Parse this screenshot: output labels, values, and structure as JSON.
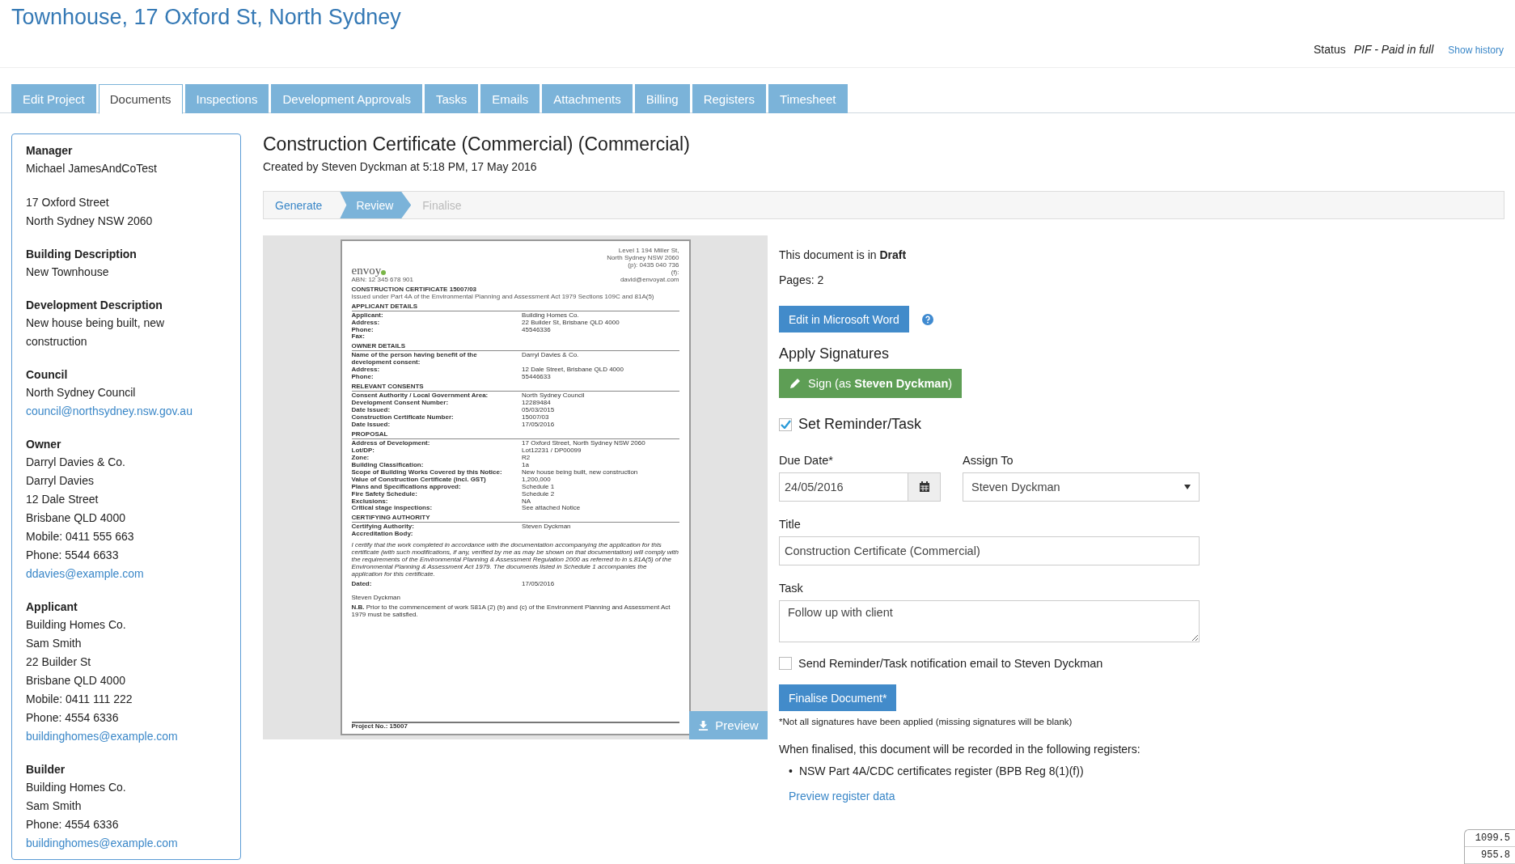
{
  "project": {
    "title": "Townhouse, 17 Oxford St, North Sydney",
    "status_label": "Status",
    "status_value": "PIF - Paid in full",
    "history_link": "Show history"
  },
  "tabs": [
    {
      "label": "Edit Project",
      "selected": false
    },
    {
      "label": "Documents",
      "selected": true
    },
    {
      "label": "Inspections",
      "selected": false
    },
    {
      "label": "Development Approvals",
      "selected": false
    },
    {
      "label": "Tasks",
      "selected": false
    },
    {
      "label": "Emails",
      "selected": false
    },
    {
      "label": "Attachments",
      "selected": false
    },
    {
      "label": "Billing",
      "selected": false
    },
    {
      "label": "Registers",
      "selected": false
    },
    {
      "label": "Timesheet",
      "selected": false
    }
  ],
  "sidebar": [
    {
      "heading": "Manager",
      "lines": [
        {
          "text": "Michael JamesAndCoTest",
          "kind": "text"
        }
      ]
    },
    {
      "lines": [
        {
          "text": "17 Oxford Street",
          "kind": "text"
        },
        {
          "text": "North Sydney NSW 2060",
          "kind": "text"
        }
      ]
    },
    {
      "heading": "Building Description",
      "lines": [
        {
          "text": "New Townhouse",
          "kind": "text"
        }
      ]
    },
    {
      "heading": "Development Description",
      "lines": [
        {
          "text": "New house being built, new construction",
          "kind": "text"
        }
      ]
    },
    {
      "heading": "Council",
      "lines": [
        {
          "text": "North Sydney Council",
          "kind": "text"
        },
        {
          "text": "council@northsydney.nsw.gov.au",
          "kind": "link"
        }
      ]
    },
    {
      "heading": "Owner",
      "lines": [
        {
          "text": "Darryl Davies & Co.",
          "kind": "text"
        },
        {
          "text": "Darryl Davies",
          "kind": "text"
        },
        {
          "text": "12 Dale Street",
          "kind": "text"
        },
        {
          "text": "Brisbane QLD 4000",
          "kind": "text"
        },
        {
          "text": "Mobile: 0411 555 663",
          "kind": "text"
        },
        {
          "text": "Phone: 5544 6633",
          "kind": "text"
        },
        {
          "text": "ddavies@example.com",
          "kind": "link"
        }
      ]
    },
    {
      "heading": "Applicant",
      "lines": [
        {
          "text": "Building Homes Co.",
          "kind": "text"
        },
        {
          "text": "Sam Smith",
          "kind": "text"
        },
        {
          "text": "22 Builder St",
          "kind": "text"
        },
        {
          "text": "Brisbane QLD 4000",
          "kind": "text"
        },
        {
          "text": "Mobile: 0411 111 222",
          "kind": "text"
        },
        {
          "text": "Phone: 4554 6336",
          "kind": "text"
        },
        {
          "text": "buildinghomes@example.com",
          "kind": "link"
        }
      ]
    },
    {
      "heading": "Builder",
      "lines": [
        {
          "text": "Building Homes Co.",
          "kind": "text"
        },
        {
          "text": "Sam Smith",
          "kind": "text"
        },
        {
          "text": "Phone: 4554 6336",
          "kind": "text"
        },
        {
          "text": "buildinghomes@example.com",
          "kind": "link"
        }
      ]
    }
  ],
  "document_header": {
    "title": "Construction Certificate (Commercial) (Commercial)",
    "created": "Created by Steven Dyckman at 5:18 PM, 17 May 2016"
  },
  "steps": [
    {
      "label": "Generate",
      "selected": false,
      "disabled": false
    },
    {
      "label": "Review",
      "selected": true,
      "disabled": false
    },
    {
      "label": "Finalise",
      "selected": false,
      "disabled": true
    }
  ],
  "document": {
    "logo": "envoy",
    "abn": "ABN: 12 345 678 901",
    "address": [
      "Level 1 194 Miller St,",
      "North Sydney NSW 2060",
      "(p): 0435 040 736",
      "(f):",
      "david@envoyat.com"
    ],
    "title": "CONSTRUCTION CERTIFICATE 15007/03",
    "subtitle": "Issued under Part 4A of the Environmental Planning and Assessment Act 1979 Sections 109C and 81A(5)",
    "sections": [
      {
        "heading": "APPLICANT DETAILS",
        "rows": [
          {
            "label": "Applicant:",
            "value": "Building Homes Co."
          },
          {
            "label": "Address:",
            "value": "22 Builder St, Brisbane QLD 4000"
          },
          {
            "label": "Phone:",
            "value": "45546336"
          },
          {
            "label": "Fax:"
          }
        ]
      },
      {
        "heading": "OWNER DETAILS",
        "rows": [
          {
            "label": "Name of the person having benefit of the development consent:",
            "value": "Darryl Davies & Co."
          },
          {
            "label": "Address:",
            "value": "12 Dale Street, Brisbane QLD 4000"
          },
          {
            "label": "Phone:",
            "value": "55446633"
          }
        ]
      },
      {
        "heading": "RELEVANT CONSENTS",
        "rows": [
          {
            "label": "Consent Authority / Local Government Area:",
            "value": "North Sydney Council"
          },
          {
            "label": "Development Consent Number:",
            "value": "12289484"
          },
          {
            "label": "Date Issued:",
            "value": "05/03/2015"
          },
          {
            "label": "Construction Certificate Number:",
            "value": "15007/03"
          },
          {
            "label": "Date Issued:",
            "value": "17/05/2016"
          }
        ]
      },
      {
        "heading": "PROPOSAL",
        "rows": [
          {
            "label": "Address of Development:",
            "value": "17 Oxford Street, North Sydney NSW 2060"
          },
          {
            "label": "Lot/DP:",
            "value": "Lot12231 / DP00099"
          },
          {
            "label": "Zone:",
            "value": "R2"
          },
          {
            "label": "Building Classification:",
            "value": "1a"
          },
          {
            "label": "Scope of Building Works Covered by this Notice:",
            "value": "New house being built, new construction"
          },
          {
            "label": "Value of Construction Certificate (incl. GST)",
            "value": "1,200,000"
          },
          {
            "label": "Plans and Specifications approved:",
            "value": "Schedule 1"
          },
          {
            "label": "Fire Safety Schedule:",
            "value": "Schedule 2"
          },
          {
            "label": "Exclusions:",
            "value": "NA"
          },
          {
            "label": "Critical stage inspections:",
            "value": "See attached Notice"
          }
        ]
      },
      {
        "heading": "CERTIFYING AUTHORITY",
        "rows": [
          {
            "label": "Certifying Authority:",
            "value": "Steven Dyckman"
          },
          {
            "label": "Accreditation Body:"
          }
        ]
      }
    ],
    "certification": "I certify that the work completed in accordance with the documentation accompanying the application for this certificate (with such modifications, if any, verified by me as may be shown on that documentation) will comply with the requirements of the Environmental Planning & Assessment Regulation 2000 as referred to in s.81A(5) of the Environmental Planning & Assessment Act 1979. The documents listed in Schedule 1 accompanies the application for this certificate.",
    "dated_label": "Dated:",
    "dated_value": "17/05/2016",
    "signatory": "Steven Dyckman",
    "note": "**N.B.** Prior to the commencement of work S81A (2) (b) and (c) of the Environment Planning and Assessment Act 1979 must be satisfied.",
    "footer": "Project No.: 15007"
  },
  "preview_button": "Preview",
  "panel": {
    "state_text": "This document is in **Draft**",
    "pages": "Pages: 2",
    "edit_button": "Edit in Microsoft Word",
    "signatures_heading": "Apply Signatures",
    "sign_button": "Sign (as **Steven Dyckman**)",
    "reminder": {
      "label": "Set Reminder/Task",
      "checked": true
    },
    "due_label": "Due Date*",
    "due_value": "24/05/2016",
    "assign_label": "Assign To",
    "assign_value": "Steven Dyckman",
    "title_label": "Title",
    "title_value": "Construction Certificate (Commercial)",
    "task_label": "Task",
    "task_value": "Follow up with client",
    "notify": {
      "label": "Send Reminder/Task notification email to Steven Dyckman",
      "checked": false
    },
    "finalise_button": "Finalise Document*",
    "finalise_note": "*Not all signatures have been applied (missing signatures will be blank)",
    "registers_text": "When finalised, this document will be recorded in the following registers:",
    "registers": [
      {
        "marker": "•",
        "text": "NSW Part 4A/CDC certificates register (BPB Reg 8(1)(f))"
      }
    ],
    "preview_link": "Preview register data"
  },
  "debug_readings": [
    "1099.5",
    "955.8"
  ]
}
